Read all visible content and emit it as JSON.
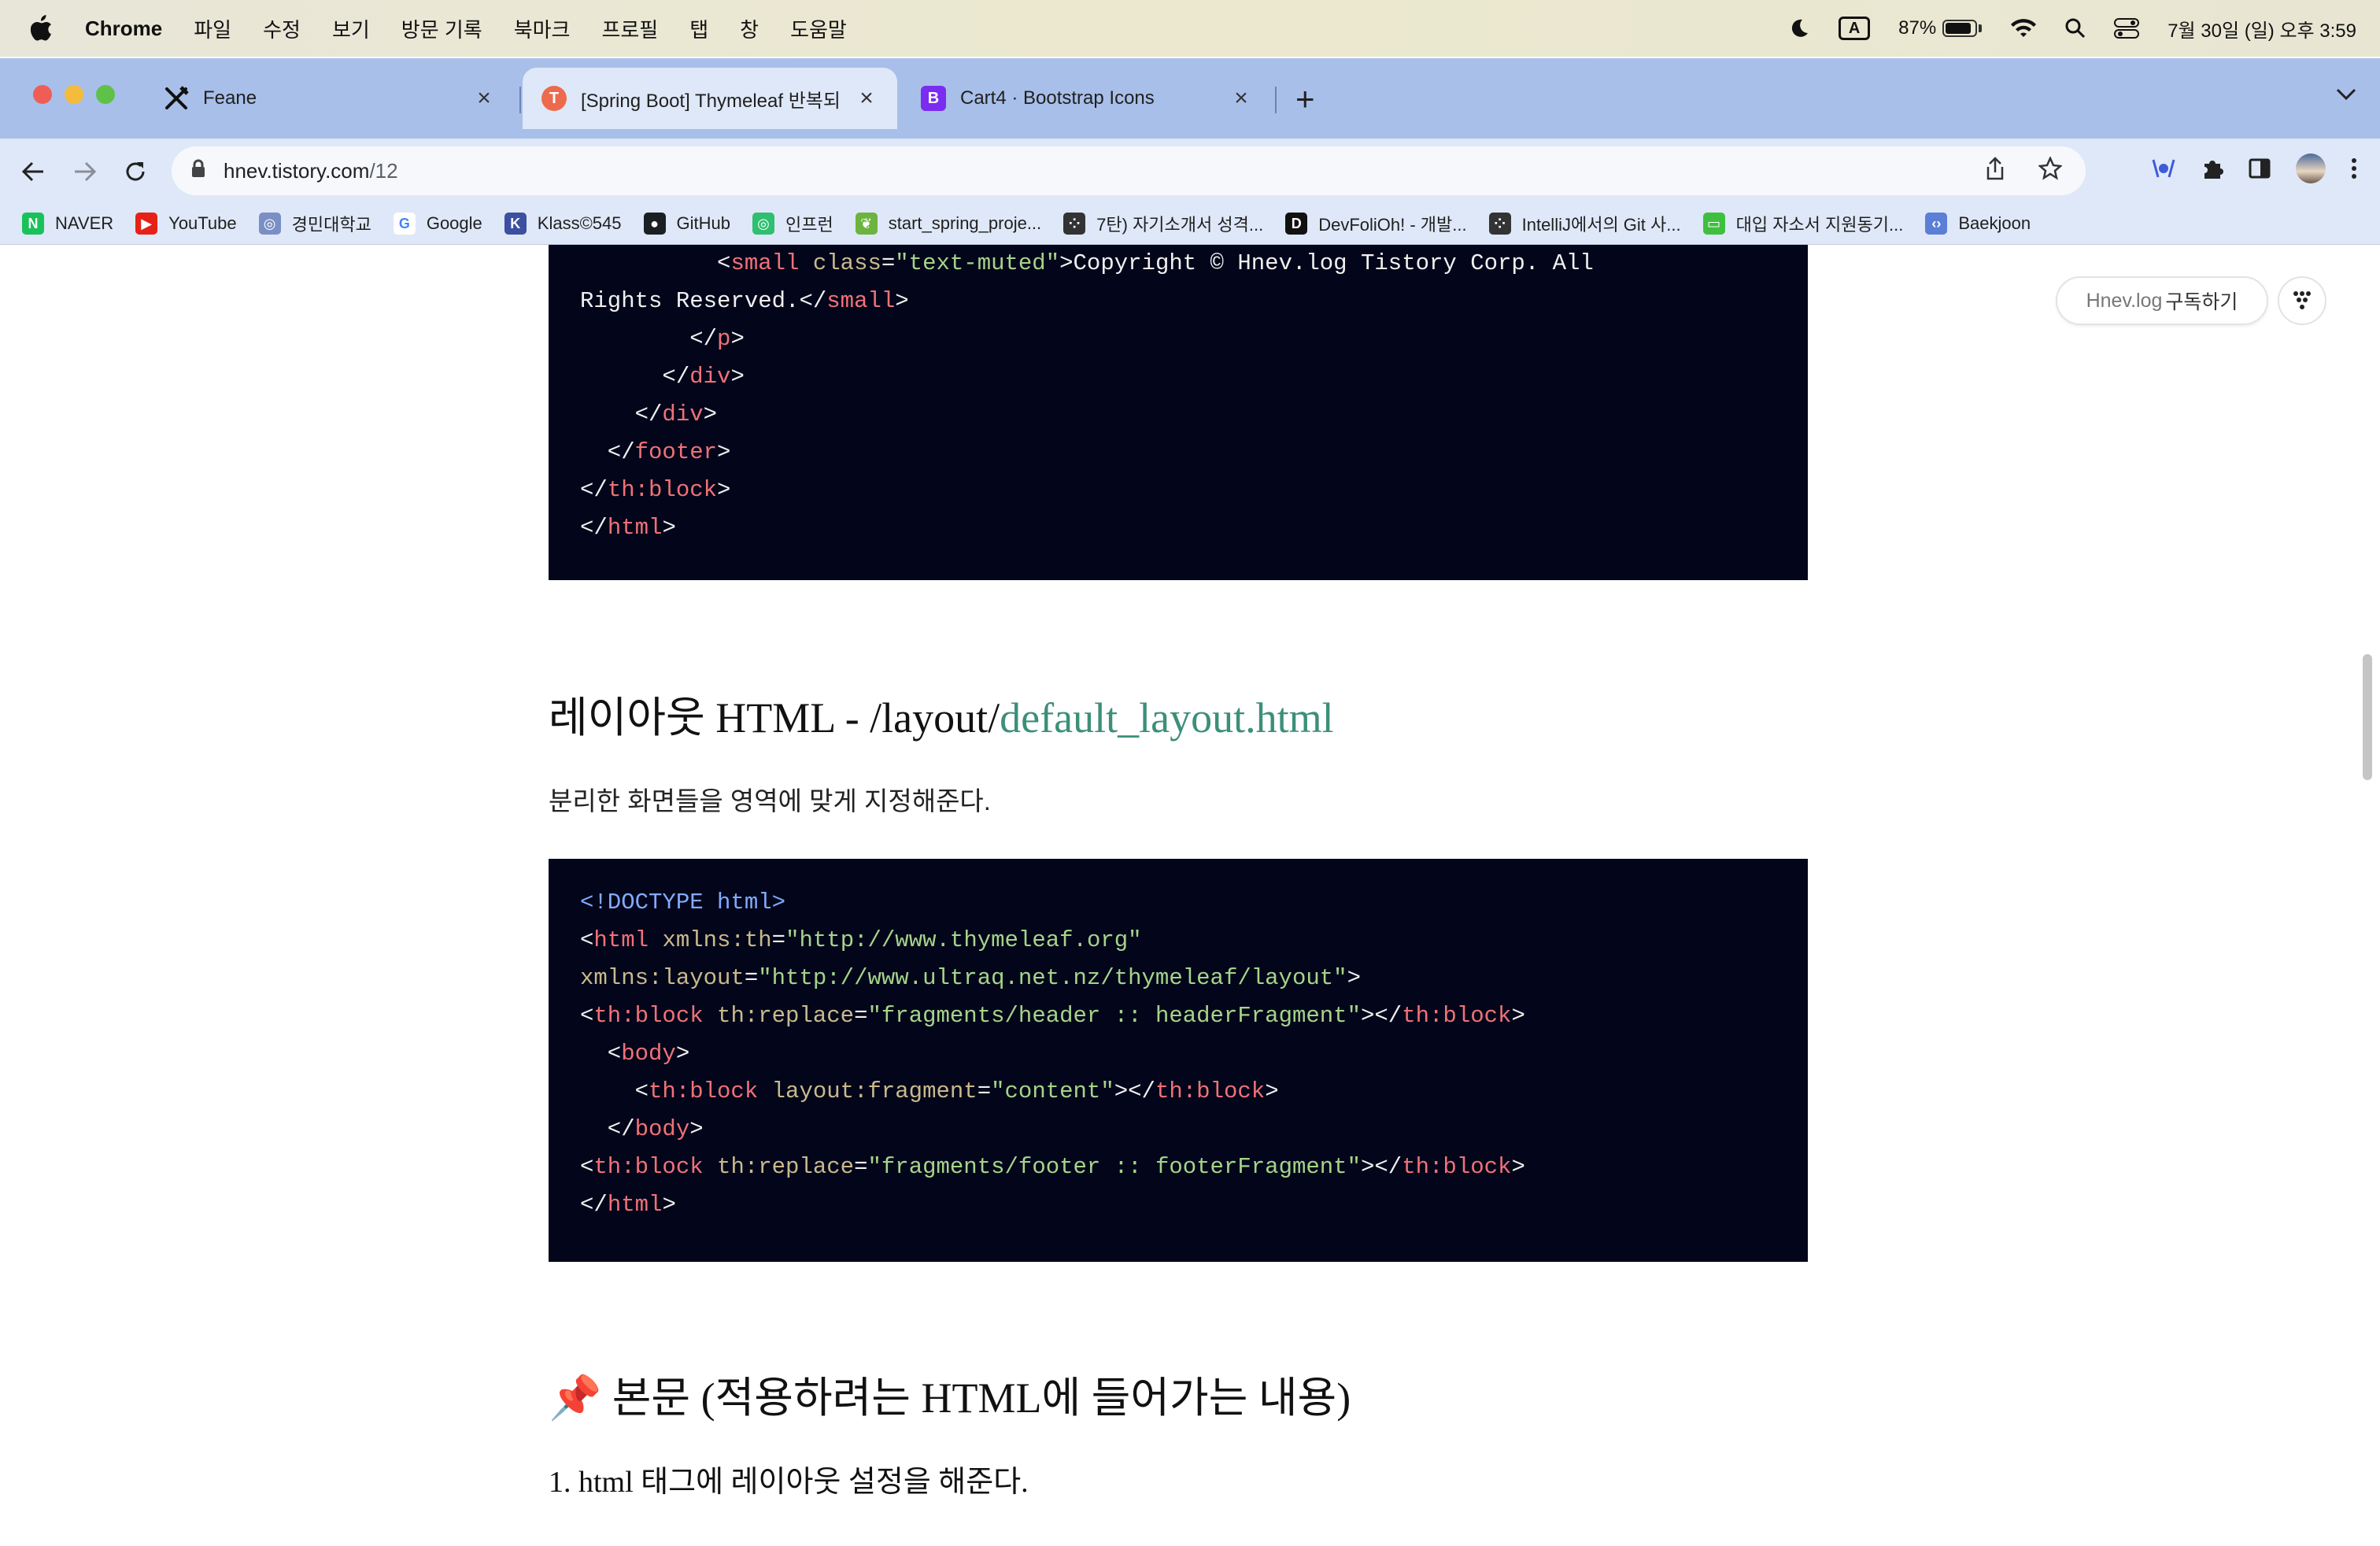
{
  "menubar": {
    "app_name": "Chrome",
    "items": [
      "파일",
      "수정",
      "보기",
      "방문 기록",
      "북마크",
      "프로필",
      "탭",
      "창",
      "도움말"
    ],
    "input_source": "A",
    "battery_percent": "87%",
    "battery_level": 0.87,
    "datetime": "7월 30일 (일) 오후 3:59"
  },
  "tabs": [
    {
      "title": "Feane",
      "favicon": "fork-knife-icon",
      "active": false
    },
    {
      "title": "[Spring Boot] Thymeleaf 반복되",
      "favicon": "tistory-icon",
      "active": true
    },
    {
      "title": "Cart4 · Bootstrap Icons",
      "favicon": "bootstrap-icon",
      "favicon_letter": "B",
      "active": false
    }
  ],
  "address": {
    "host": "hnev.tistory.com",
    "path": "/12"
  },
  "bookmarks": [
    {
      "label": "NAVER",
      "icon": "naver-icon",
      "letter": "N",
      "color": "#19c15a"
    },
    {
      "label": "YouTube",
      "icon": "youtube-icon",
      "letter": "▶",
      "color": "#e62117"
    },
    {
      "label": "경민대학교",
      "icon": "university-icon",
      "letter": "◎",
      "color": "#7a8fc4"
    },
    {
      "label": "Google",
      "icon": "google-icon",
      "letter": "G",
      "color": "#ffffff"
    },
    {
      "label": "Klass©545",
      "icon": "klass-icon",
      "letter": "K",
      "color": "#3d4fa0"
    },
    {
      "label": "GitHub",
      "icon": "github-icon",
      "letter": "●",
      "color": "#1b1f23"
    },
    {
      "label": "인프런",
      "icon": "inflearn-icon",
      "letter": "◎",
      "color": "#2fbf71"
    },
    {
      "label": "start_spring_proje...",
      "icon": "spring-icon",
      "letter": "❦",
      "color": "#6db33f"
    },
    {
      "label": "7탄) 자기소개서 성격...",
      "icon": "tistory-dots-icon",
      "letter": "⁘",
      "color": "#333333"
    },
    {
      "label": "DevFoliOh! - 개발...",
      "icon": "devfolio-icon",
      "letter": "D",
      "color": "#111111"
    },
    {
      "label": "IntelliJ에서의 Git 사...",
      "icon": "tistory-dots-icon",
      "letter": "⁘",
      "color": "#333333"
    },
    {
      "label": "대입 자소서 지원동기...",
      "icon": "chat-icon",
      "letter": "▭",
      "color": "#3fbf3f"
    },
    {
      "label": "Baekjoon",
      "icon": "code-icon",
      "letter": "‹›",
      "color": "#5b7fd6"
    }
  ],
  "page": {
    "subscribe_brand": "Hnev.log",
    "subscribe_label": "구독하기",
    "code_block_1": [
      [
        [
          "c-p",
          "          <"
        ],
        [
          "c-tag",
          "small"
        ],
        [
          "c-p",
          " "
        ],
        [
          "c-attr",
          "class"
        ],
        [
          "c-p",
          "="
        ],
        [
          "c-str",
          "\"text-muted\""
        ],
        [
          "c-p",
          ">Copyright © Hnev.log Tistory Corp. All"
        ]
      ],
      [
        [
          "c-p",
          "Rights Reserved.</"
        ],
        [
          "c-tag",
          "small"
        ],
        [
          "c-p",
          ">"
        ]
      ],
      [
        [
          "c-p",
          "        </"
        ],
        [
          "c-tag",
          "p"
        ],
        [
          "c-p",
          ">"
        ]
      ],
      [
        [
          "c-p",
          "      </"
        ],
        [
          "c-tag",
          "div"
        ],
        [
          "c-p",
          ">"
        ]
      ],
      [
        [
          "c-p",
          "    </"
        ],
        [
          "c-tag",
          "div"
        ],
        [
          "c-p",
          ">"
        ]
      ],
      [
        [
          "c-p",
          "  </"
        ],
        [
          "c-tag",
          "footer"
        ],
        [
          "c-p",
          ">"
        ]
      ],
      [
        [
          "c-p",
          "</"
        ],
        [
          "c-tag",
          "th:block"
        ],
        [
          "c-p",
          ">"
        ]
      ],
      [
        [
          "c-p",
          "</"
        ],
        [
          "c-tag",
          "html"
        ],
        [
          "c-p",
          ">"
        ]
      ]
    ],
    "heading_1_prefix": "레이아웃 HTML - /layout/",
    "heading_1_accent": "default_layout.html",
    "paragraph_1": "분리한 화면들을 영역에 맞게 지정해준다.",
    "code_block_2": [
      [
        [
          "c-doc",
          "<!DOCTYPE html>"
        ]
      ],
      [
        [
          "c-p",
          "<"
        ],
        [
          "c-tag",
          "html"
        ],
        [
          "c-p",
          " "
        ],
        [
          "c-attr",
          "xmlns:th"
        ],
        [
          "c-p",
          "="
        ],
        [
          "c-str",
          "\"http://www.thymeleaf.org\""
        ]
      ],
      [
        [
          "c-attr",
          "xmlns:layout"
        ],
        [
          "c-p",
          "="
        ],
        [
          "c-str",
          "\"http://www.ultraq.net.nz/thymeleaf/layout\""
        ],
        [
          "c-p",
          ">"
        ]
      ],
      [
        [
          "c-p",
          "<"
        ],
        [
          "c-tag",
          "th:block"
        ],
        [
          "c-p",
          " "
        ],
        [
          "c-attr",
          "th:replace"
        ],
        [
          "c-p",
          "="
        ],
        [
          "c-str",
          "\"fragments/header :: headerFragment\""
        ],
        [
          "c-p",
          "></"
        ],
        [
          "c-tag",
          "th:block"
        ],
        [
          "c-p",
          ">"
        ]
      ],
      [
        [
          "c-p",
          "  <"
        ],
        [
          "c-tag",
          "body"
        ],
        [
          "c-p",
          ">"
        ]
      ],
      [
        [
          "c-p",
          "    <"
        ],
        [
          "c-tag",
          "th:block"
        ],
        [
          "c-p",
          " "
        ],
        [
          "c-attr",
          "layout:fragment"
        ],
        [
          "c-p",
          "="
        ],
        [
          "c-str",
          "\"content\""
        ],
        [
          "c-p",
          "></"
        ],
        [
          "c-tag",
          "th:block"
        ],
        [
          "c-p",
          ">"
        ]
      ],
      [
        [
          "c-p",
          "  </"
        ],
        [
          "c-tag",
          "body"
        ],
        [
          "c-p",
          ">"
        ]
      ],
      [
        [
          "c-p",
          "<"
        ],
        [
          "c-tag",
          "th:block"
        ],
        [
          "c-p",
          " "
        ],
        [
          "c-attr",
          "th:replace"
        ],
        [
          "c-p",
          "="
        ],
        [
          "c-str",
          "\"fragments/footer :: footerFragment\""
        ],
        [
          "c-p",
          "></"
        ],
        [
          "c-tag",
          "th:block"
        ],
        [
          "c-p",
          ">"
        ]
      ],
      [
        [
          "c-p",
          "</"
        ],
        [
          "c-tag",
          "html"
        ],
        [
          "c-p",
          ">"
        ]
      ]
    ],
    "heading_2_emoji": "📌",
    "heading_2": "본문 (적용하려는 HTML에 들어가는 내용)",
    "heading_3": "1. html 태그에 레이아웃 설정을 해준다."
  }
}
